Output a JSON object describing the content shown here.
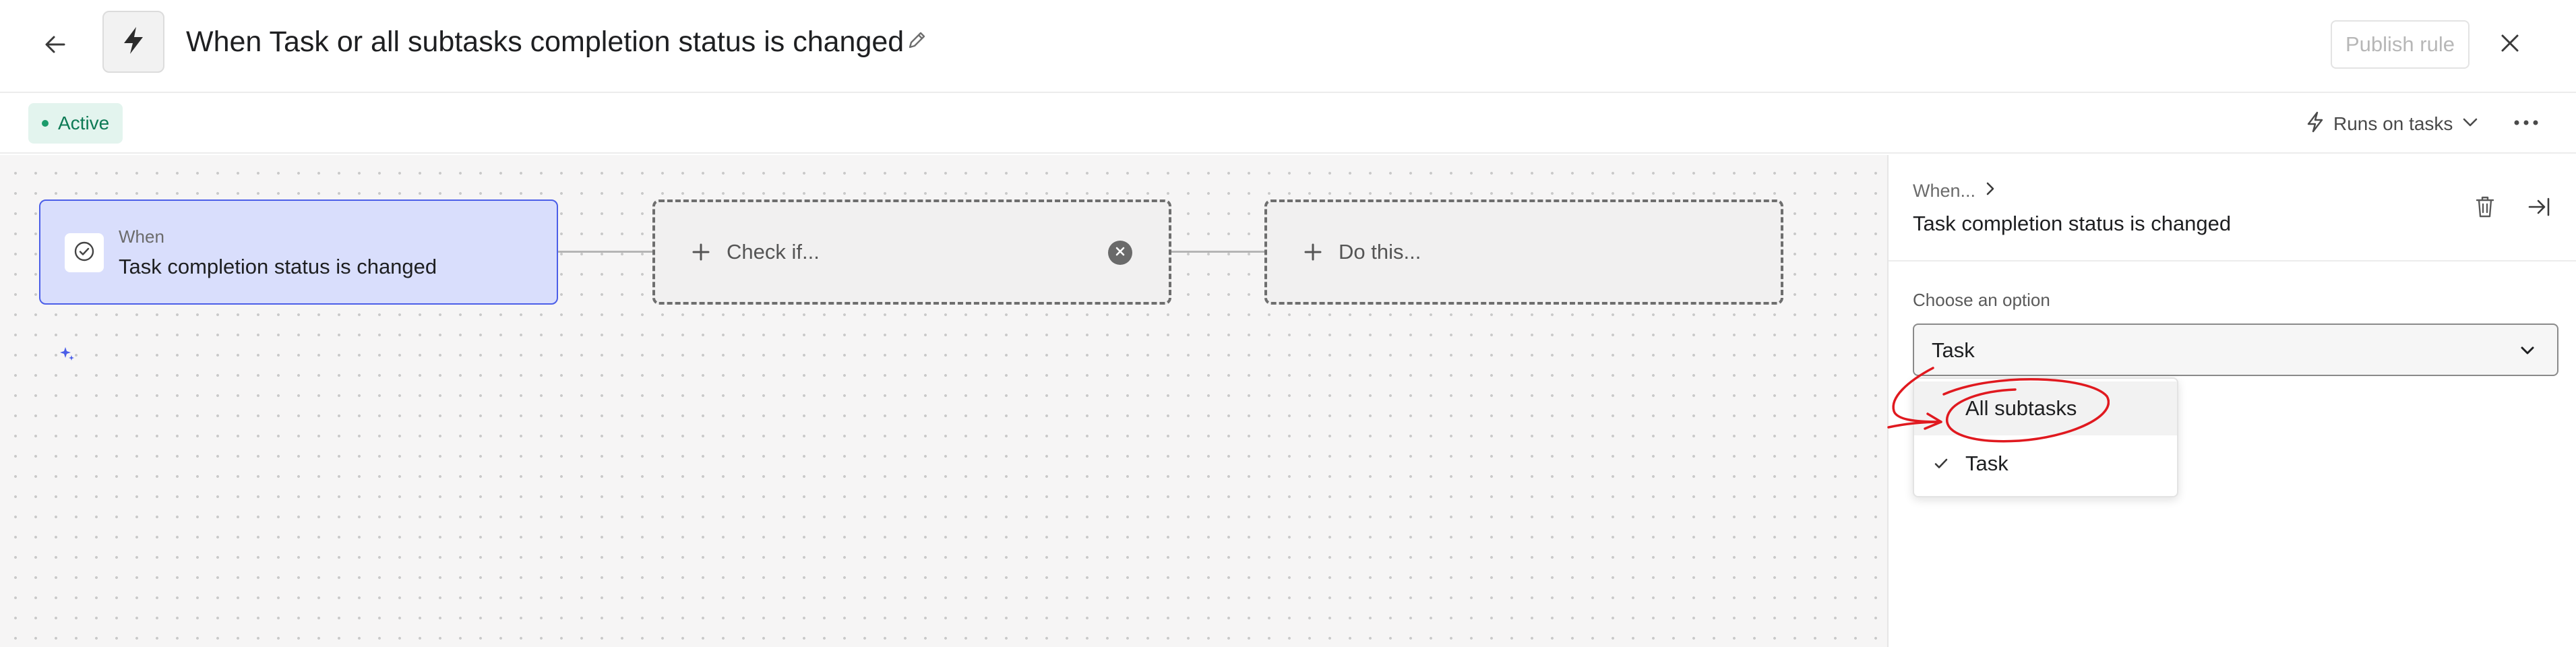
{
  "header": {
    "back_label": "Back",
    "title": "When Task or all subtasks completion status is changed",
    "publish_label": "Publish rule"
  },
  "subheader": {
    "status": "Active",
    "runs_on": "Runs on tasks"
  },
  "canvas": {
    "trigger": {
      "prefix": "When",
      "text": "Task completion status is changed"
    },
    "condition": {
      "label": "Check if..."
    },
    "action": {
      "label": "Do this..."
    }
  },
  "panel": {
    "breadcrumb": "When...",
    "title": "Task completion status is changed",
    "option_label": "Choose an option",
    "selected_value": "Task"
  },
  "dropdown": {
    "options": [
      {
        "label": "All subtasks",
        "selected": false,
        "hovered": true
      },
      {
        "label": "Task",
        "selected": true,
        "hovered": false
      }
    ]
  },
  "colors": {
    "trigger_bg": "#d9defc",
    "trigger_border": "#4b5ee8",
    "active_badge_bg": "#e3f4ee",
    "active_text": "#0d7a55",
    "annotation": "#e0191f",
    "canvas_bg": "#f6f5f5"
  },
  "icons": {
    "back": "arrow-left-icon",
    "rule": "lightning-bolt-icon",
    "edit": "pencil-icon",
    "close": "close-icon",
    "runs_on": "lightning-outline-icon",
    "more": "more-horizontal-icon",
    "trigger": "check-circle-icon",
    "add": "plus-icon",
    "remove": "remove-circle-icon",
    "sparkle": "ai-sparkle-icon",
    "trash": "trash-icon",
    "collapse": "collapse-right-icon"
  }
}
